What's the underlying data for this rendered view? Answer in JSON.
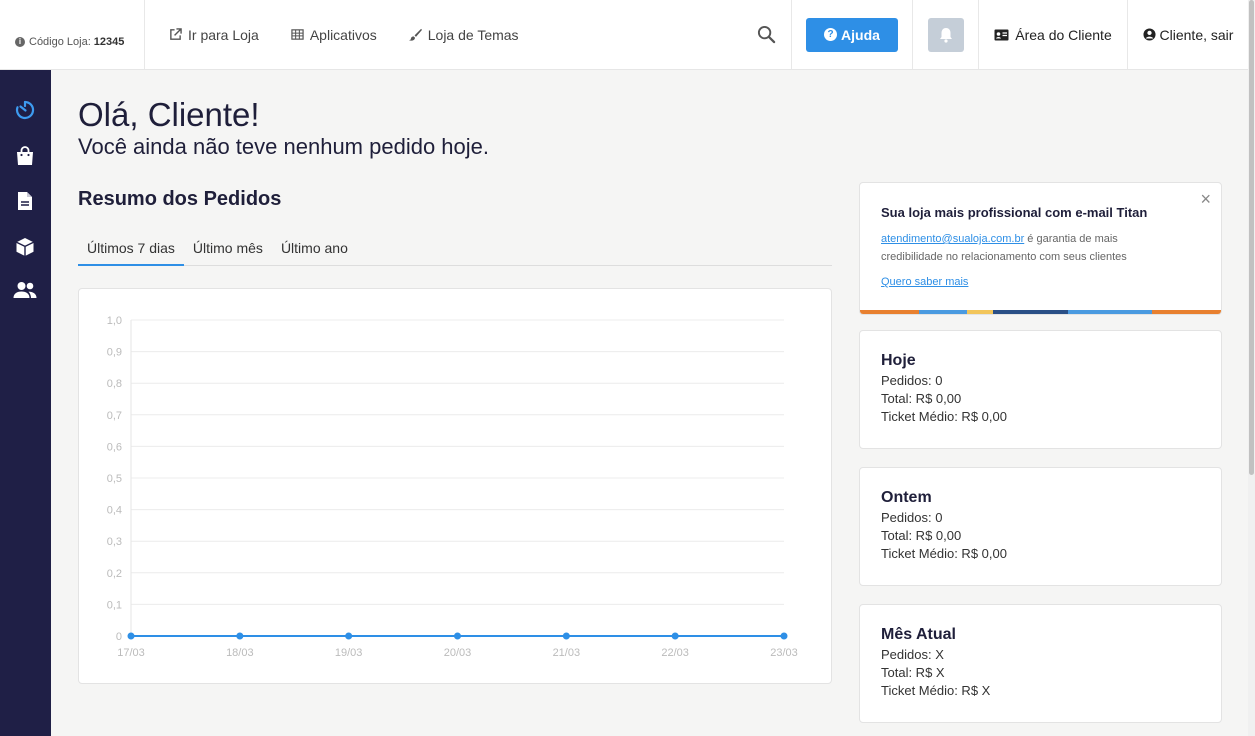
{
  "topbar": {
    "store_code_label": "Código Loja:",
    "store_code_value": "12345",
    "nav": [
      {
        "label": "Ir para Loja",
        "icon": "external-link-icon"
      },
      {
        "label": "Aplicativos",
        "icon": "grid-icon"
      },
      {
        "label": "Loja de Temas",
        "icon": "brush-icon"
      }
    ],
    "help_label": "Ajuda",
    "client_area_label": "Área do Cliente",
    "logout_label": "Cliente, sair"
  },
  "sidebar": {
    "items": [
      {
        "icon": "dashboard-timer-icon",
        "active": true
      },
      {
        "icon": "shopping-bag-icon"
      },
      {
        "icon": "document-icon"
      },
      {
        "icon": "box-icon"
      },
      {
        "icon": "users-icon"
      }
    ]
  },
  "main": {
    "greeting": "Olá, Cliente!",
    "subgreeting": "Você ainda não teve nenhum pedido hoje.",
    "section_title": "Resumo dos Pedidos",
    "tabs": [
      "Últimos 7 dias",
      "Último mês",
      "Último ano"
    ]
  },
  "chart_data": {
    "type": "line",
    "x": [
      "17/03",
      "18/03",
      "19/03",
      "20/03",
      "21/03",
      "22/03",
      "23/03"
    ],
    "series": [
      {
        "values": [
          0,
          0,
          0,
          0,
          0,
          0,
          0
        ]
      }
    ],
    "yticks": [
      "0",
      "0,1",
      "0,2",
      "0,3",
      "0,4",
      "0,5",
      "0,6",
      "0,7",
      "0,8",
      "0,9",
      "1,0"
    ],
    "ylim": [
      0,
      1
    ],
    "grid": true,
    "color": "#2e8fe6"
  },
  "promo": {
    "title": "Sua loja mais profissional com e-mail Titan",
    "email": "atendimento@sualoja.com.br",
    "text_after_email": " é garantia de mais credibilidade no relacionamento com seus clientes",
    "link": "Quero saber mais",
    "close": "×"
  },
  "stats": [
    {
      "title": "Hoje",
      "pedidos": "Pedidos: 0",
      "total": "Total: R$ 0,00",
      "ticket": "Ticket Médio: R$ 0,00"
    },
    {
      "title": "Ontem",
      "pedidos": "Pedidos: 0",
      "total": "Total: R$ 0,00",
      "ticket": "Ticket Médio: R$ 0,00"
    },
    {
      "title": "Mês Atual",
      "pedidos": "Pedidos: X",
      "total": "Total: R$ X",
      "ticket": "Ticket Médio: R$ X"
    }
  ]
}
